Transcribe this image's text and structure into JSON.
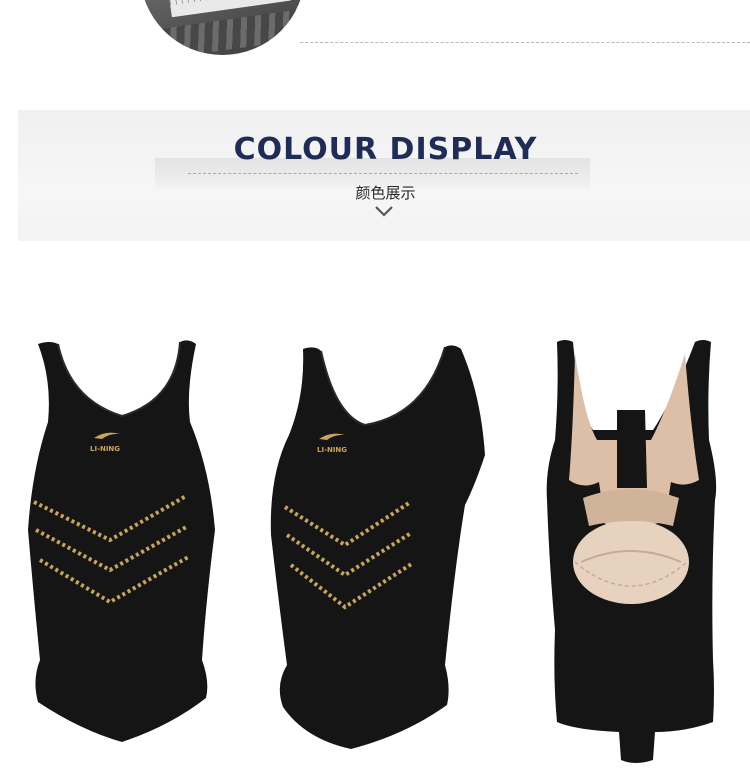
{
  "section_heading": {
    "title": "COLOUR DISPLAY",
    "subtitle": "颜色展示"
  },
  "brand_logo_text": "LI-NING",
  "colors": {
    "navy_title": "#1f2c57",
    "suit_black": "#151515",
    "gold_accent": "#c9a55a",
    "lining_beige": "#dcbfa6"
  },
  "images": [
    {
      "name": "front-view"
    },
    {
      "name": "side-view"
    },
    {
      "name": "back-view"
    }
  ]
}
